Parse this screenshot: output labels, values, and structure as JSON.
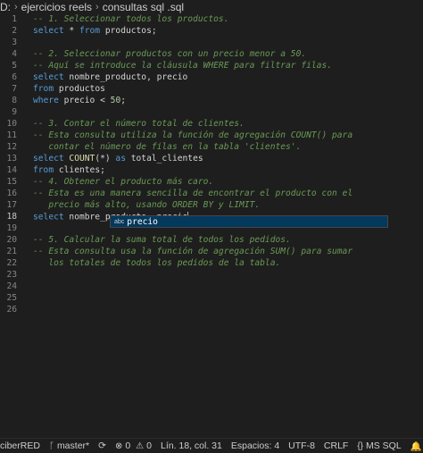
{
  "breadcrumb": {
    "drive": "D:",
    "folder": "ejercicios reels",
    "file": "consultas sql .sql"
  },
  "editor": {
    "active_line": 18,
    "lines": [
      {
        "n": "1"
      },
      {
        "n": "2"
      },
      {
        "n": "3"
      },
      {
        "n": "4"
      },
      {
        "n": "5"
      },
      {
        "n": "6"
      },
      {
        "n": "7"
      },
      {
        "n": "8"
      },
      {
        "n": "9"
      },
      {
        "n": "10"
      },
      {
        "n": "11"
      },
      {
        "n": "12"
      },
      {
        "n": "13"
      },
      {
        "n": "14"
      },
      {
        "n": "15"
      },
      {
        "n": "16"
      },
      {
        "n": "17"
      },
      {
        "n": "18"
      },
      {
        "n": "19"
      },
      {
        "n": "20"
      },
      {
        "n": "21"
      },
      {
        "n": "22"
      },
      {
        "n": "23"
      },
      {
        "n": "24"
      },
      {
        "n": "25"
      },
      {
        "n": "26"
      }
    ],
    "code": {
      "l1_comment": "-- 1. Seleccionar todos los productos.",
      "l2_select": "select",
      "l2_rest": " * ",
      "l2_from": "from",
      "l2_table": " productos;",
      "l4_comment": "-- 2. Seleccionar productos con un precio menor a 50.",
      "l5_comment": "-- Aquí se introduce la cláusula WHERE para filtrar filas.",
      "l6_select": "select",
      "l6_cols": " nombre_producto, precio",
      "l7_from": "from",
      "l7_table": " productos",
      "l8_where": "where",
      "l8_col": " precio ",
      "l8_op": "< ",
      "l8_num": "50",
      "l8_end": ";",
      "l10_comment": "-- 3. Contar el número total de clientes.",
      "l11_comment": "-- Esta consulta utiliza la función de agregación COUNT() para",
      "l12_comment": "   contar el número de filas en la tabla 'clientes'.",
      "l13_select": "select",
      "l13_fn": " COUNT",
      "l13_args": "(*) ",
      "l13_as": "as",
      "l13_alias": " total_clientes",
      "l14_from": "from",
      "l14_table": " clientes;",
      "l15_comment": "-- 4. Obtener el producto más caro.",
      "l16_comment": "-- Esta es una manera sencilla de encontrar el producto con el",
      "l17_comment": "   precio más alto, usando ORDER BY y LIMIT.",
      "l18_select": "select",
      "l18_rest": " nombre_producto. precio",
      "l20_comment": "-- 5. Calcular la suma total de todos los pedidos.",
      "l21_comment": "-- Esta consulta usa la función de agregación SUM() para sumar",
      "l22_comment": "   los totales de todos los pedidos de la tabla."
    },
    "suggestion": {
      "kind_label": "abc",
      "text": "precio"
    }
  },
  "statusbar": {
    "remote": "ciberRED",
    "branch": "master*",
    "errors": "0",
    "warnings": "0",
    "position": "Lín. 18, col. 31",
    "spaces": "Espacios: 4",
    "encoding": "UTF-8",
    "eol": "CRLF",
    "language": "MS SQL"
  },
  "colors": {
    "background": "#1e1e1e",
    "keyword": "#569cd6",
    "comment": "#6a9955",
    "function": "#dcdcaa",
    "number": "#b5cea8",
    "suggest_highlight": "#04395e"
  }
}
